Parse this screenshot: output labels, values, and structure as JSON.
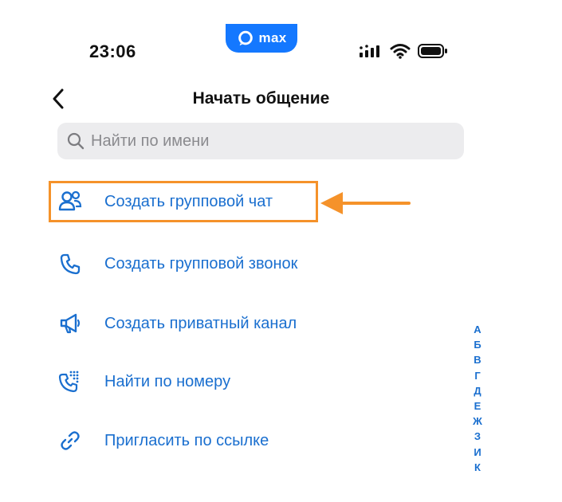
{
  "status_bar": {
    "time": "23:06",
    "island_label": "max",
    "icons": [
      "signal-icon",
      "wifi-icon",
      "battery-icon"
    ]
  },
  "header": {
    "title": "Начать общение",
    "back_icon": "chevron-left-icon"
  },
  "search": {
    "placeholder": "Найти по имени",
    "value": "",
    "icon": "search-icon"
  },
  "menu": {
    "items": [
      {
        "label": "Создать групповой чат",
        "icon": "group-icon"
      },
      {
        "label": "Создать групповой звонок",
        "icon": "phone-icon"
      },
      {
        "label": "Создать приватный канал",
        "icon": "megaphone-icon"
      },
      {
        "label": "Найти по номеру",
        "icon": "dialpad-phone-icon"
      },
      {
        "label": "Пригласить по ссылке",
        "icon": "link-icon"
      }
    ],
    "highlighted_index": 0
  },
  "alphabet_index": [
    "А",
    "Б",
    "В",
    "Г",
    "Д",
    "Е",
    "Ж",
    "З",
    "И",
    "К"
  ],
  "colors": {
    "accent": "#1a6fcf",
    "highlight": "#f5922a",
    "island": "#1478ff",
    "search_bg": "#ececee"
  }
}
